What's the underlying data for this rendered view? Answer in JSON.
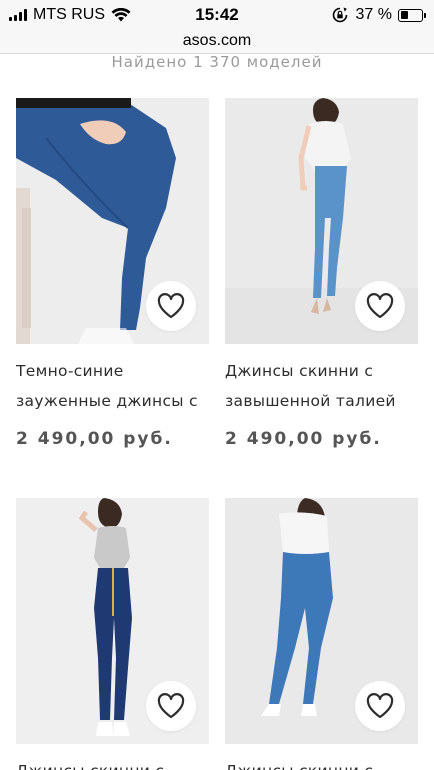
{
  "status_bar": {
    "carrier": "MTS RUS",
    "time": "15:42",
    "battery_percent": "37 %",
    "battery_level": 0.37,
    "icons": [
      "signal-icon",
      "wifi-icon",
      "rotation-lock-icon",
      "battery-icon"
    ]
  },
  "browser": {
    "url": "asos.com"
  },
  "results": {
    "count_text": "Найдено 1 370 моделей"
  },
  "products": [
    {
      "name_line1": "Темно-синие",
      "name_line2": "зауженные джинсы с",
      "price": "2 490,00 руб.",
      "favorite_icon": "heart-outline-icon"
    },
    {
      "name_line1": "Джинсы скинни с",
      "name_line2": "завышенной талией",
      "price": "2 490,00 руб.",
      "favorite_icon": "heart-outline-icon"
    },
    {
      "name_line1": "Джинсы скинни с",
      "favorite_icon": "heart-outline-icon"
    },
    {
      "name_line1": "Джинсы скинни с",
      "favorite_icon": "heart-outline-icon"
    }
  ],
  "colors": {
    "price": "#555555",
    "muted_text": "#9a9a9a",
    "dark_denim": "#1f3a72",
    "mid_denim": "#3d78b8",
    "light_denim": "#5a93c9"
  }
}
